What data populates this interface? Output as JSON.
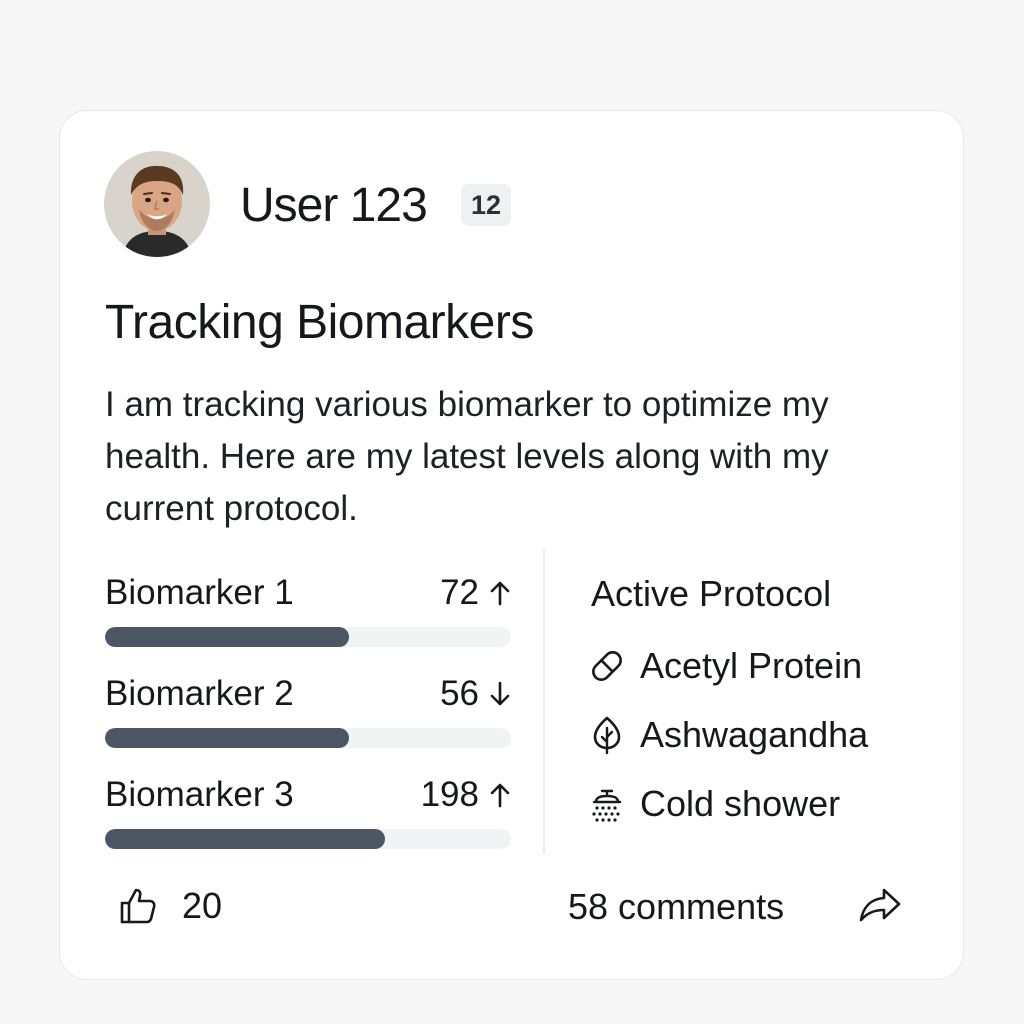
{
  "post": {
    "author": {
      "name": "User 123",
      "badge": "12"
    },
    "title": "Tracking Biomarkers",
    "body": "I am tracking various biomarker to optimize my health. Here are my latest levels along with my current protocol.",
    "biomarkers": [
      {
        "name": "Biomarker 1",
        "value": "72",
        "trend": "up",
        "fill_percent": 60
      },
      {
        "name": "Biomarker 2",
        "value": "56",
        "trend": "down",
        "fill_percent": 60
      },
      {
        "name": "Biomarker 3",
        "value": "198",
        "trend": "up",
        "fill_percent": 69
      }
    ],
    "protocol": {
      "title": "Active Protocol",
      "items": [
        {
          "label": "Acetyl Protein",
          "icon": "pill-icon"
        },
        {
          "label": "Ashwagandha",
          "icon": "leaf-icon"
        },
        {
          "label": "Cold shower",
          "icon": "shower-icon"
        }
      ]
    },
    "footer": {
      "likes": "20",
      "comments_label": "58 comments"
    }
  },
  "colors": {
    "bar_fill": "#4c5664",
    "bar_track": "#f2f3f4",
    "text": "#16181c",
    "badge_bg": "#eef0f2"
  }
}
